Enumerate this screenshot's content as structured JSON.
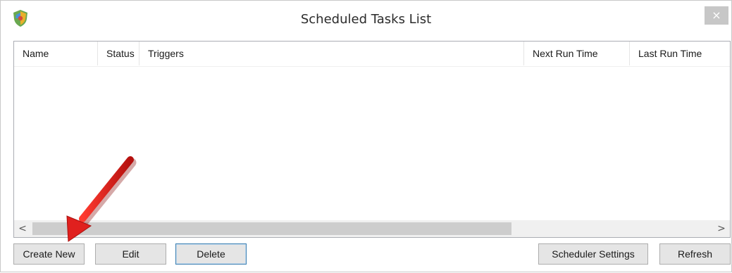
{
  "window": {
    "title": "Scheduled Tasks List",
    "close_label": "×"
  },
  "list": {
    "columns": [
      "Name",
      "Status",
      "Triggers",
      "Next Run Time",
      "Last Run Time"
    ],
    "rows": [],
    "scroll_left_label": "<",
    "scroll_right_label": ">"
  },
  "buttons": {
    "create_new": "Create New",
    "edit": "Edit",
    "delete": "Delete",
    "scheduler_settings": "Scheduler Settings",
    "refresh": "Refresh"
  },
  "colors": {
    "annotation_arrow": "#e0201e",
    "focus_border": "#3c7fb1"
  }
}
